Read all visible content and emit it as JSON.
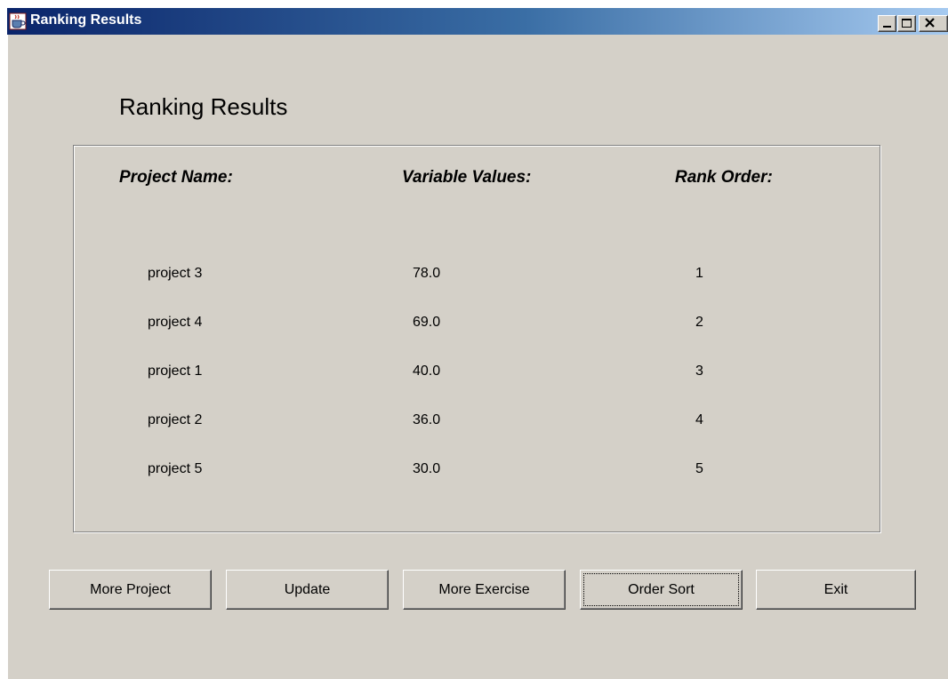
{
  "window": {
    "title": "Ranking Results",
    "app_icon": "java-coffee-cup-icon",
    "controls": {
      "minimize_icon": "minimize-icon",
      "maximize_icon": "maximize-icon",
      "close_icon": "close-icon"
    }
  },
  "heading": "Ranking Results",
  "table": {
    "columns": [
      "Project Name:",
      "Variable Values:",
      "Rank Order:"
    ],
    "rows": [
      {
        "name": "project 3",
        "value": "78.0",
        "rank": "1"
      },
      {
        "name": "project 4",
        "value": "69.0",
        "rank": "2"
      },
      {
        "name": "project 1",
        "value": "40.0",
        "rank": "3"
      },
      {
        "name": "project 2",
        "value": "36.0",
        "rank": "4"
      },
      {
        "name": "project 5",
        "value": "30.0",
        "rank": "5"
      }
    ]
  },
  "buttons": {
    "more_project": "More Project",
    "update": "Update",
    "more_exercise": "More Exercise",
    "order_sort": "Order Sort",
    "exit": "Exit"
  },
  "colors": {
    "window_bg": "#d4d0c8",
    "titlebar_start": "#0a246a",
    "titlebar_end": "#a6caf0"
  }
}
